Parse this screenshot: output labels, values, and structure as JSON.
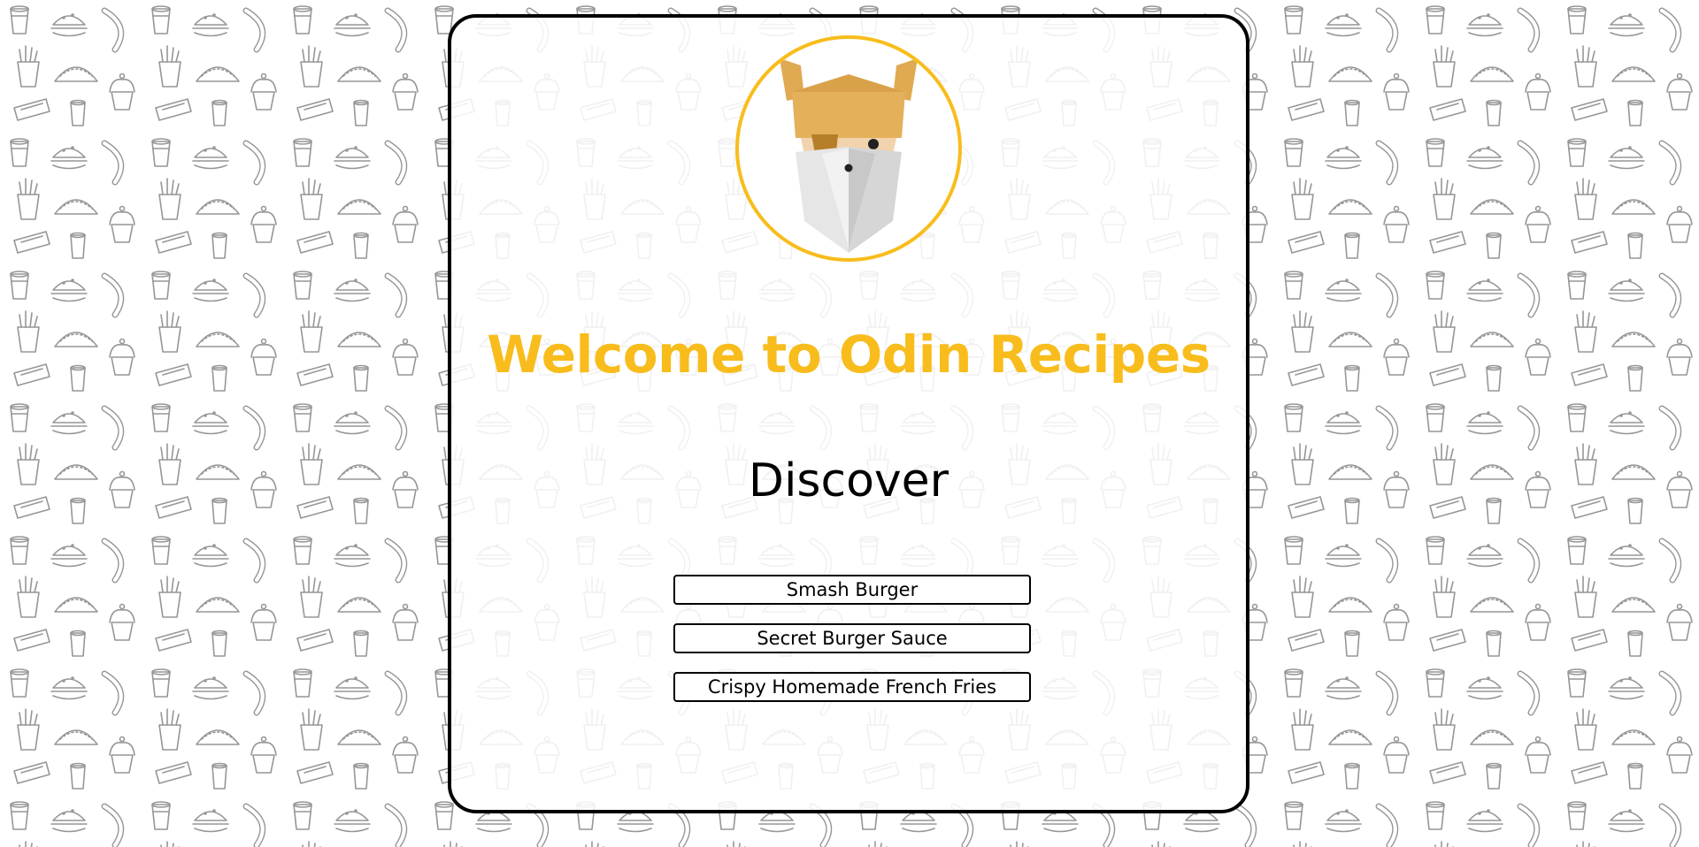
{
  "page": {
    "title": "Welcome to Odin Recipes",
    "subtitle": "Discover"
  },
  "logo": {
    "icon": "odin-viking-icon"
  },
  "recipes": [
    {
      "label": "Smash Burger"
    },
    {
      "label": "Secret Burger Sauce"
    },
    {
      "label": "Crispy Homemade French Fries"
    }
  ],
  "colors": {
    "accent": "#f8bd1c",
    "text": "#000000",
    "background": "#ffffff",
    "pattern": "#8a8a8a"
  },
  "background_pattern": {
    "icon": "food-doodle-pattern"
  }
}
